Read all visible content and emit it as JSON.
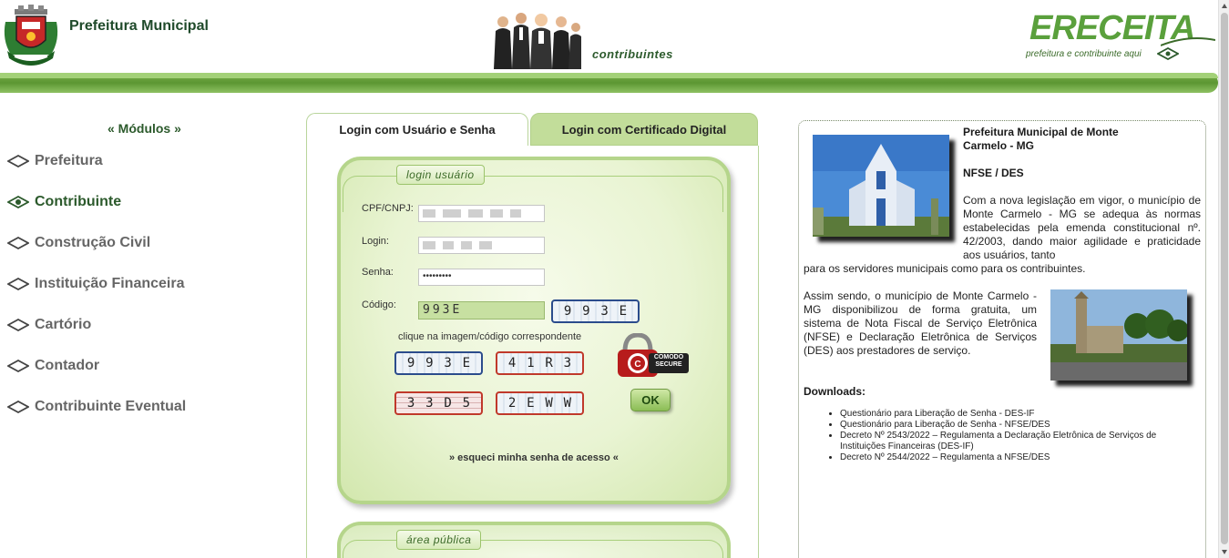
{
  "header": {
    "title": "Prefeitura Municipal",
    "contrib_label": "contribuintes",
    "logo_text": "ERECEITA",
    "logo_tagline": "prefeitura e contribuinte aqui"
  },
  "sidebar": {
    "title": "« Módulos »",
    "items": [
      {
        "label": "Prefeitura",
        "active": false
      },
      {
        "label": "Contribuinte",
        "active": true
      },
      {
        "label": "Construção Civil",
        "active": false
      },
      {
        "label": "Instituição Financeira",
        "active": false
      },
      {
        "label": "Cartório",
        "active": false
      },
      {
        "label": "Contador",
        "active": false
      },
      {
        "label": "Contribuinte Eventual",
        "active": false
      }
    ]
  },
  "tabs": {
    "user": "Login com Usuário e Senha",
    "cert": "Login com Certificado Digital"
  },
  "login": {
    "box_label": "login usuário",
    "cpf_label": "CPF/CNPJ:",
    "login_label": "Login:",
    "password_label": "Senha:",
    "password_value": "•••••••••",
    "code_label": "Código:",
    "code_value": "993E",
    "hint": "clique na imagem/código correspondente",
    "ok": "OK",
    "forgot": "» esqueci minha senha de acesso «",
    "captchas": [
      "993E",
      "993E",
      "41R3",
      "33D5",
      "2EWW"
    ],
    "comodo_text": "COMODO SECURE"
  },
  "public_area": {
    "label": "área pública"
  },
  "info": {
    "title": "Prefeitura Municipal de Monte Carmelo - MG",
    "subtitle": "NFSE / DES",
    "para1": "Com a nova legislação em vigor, o município de Monte Carmelo - MG se adequa às normas estabelecidas pela emenda constitucional nº. 42/2003, dando maior agilidade e praticidade aos usuários, tanto",
    "para1_tail": "para os servidores municipais como para os contribuintes.",
    "para2": "Assim sendo, o município de Monte Carmelo - MG disponibilizou de forma gratuita, um sistema de Nota Fiscal de Serviço Eletrônica (NFSE) e Declaração Eletrônica de Serviços (DES) aos prestadores de serviço.",
    "downloads_title": "Downloads:",
    "downloads": [
      "Questionário para Liberação de Senha - DES-IF",
      "Questionário para Liberação de Senha - NFSE/DES",
      "Decreto Nº 2543/2022 – Regulamenta a Declaração Eletrônica de Serviços de Instituições Financeiras (DES-IF)",
      "Decreto Nº 2544/2022 – Regulamenta a NFSE/DES"
    ]
  },
  "colors": {
    "brand_green": "#5b9632",
    "light_green": "#c2dd9a",
    "dark_green_text": "#2c5a2c"
  }
}
